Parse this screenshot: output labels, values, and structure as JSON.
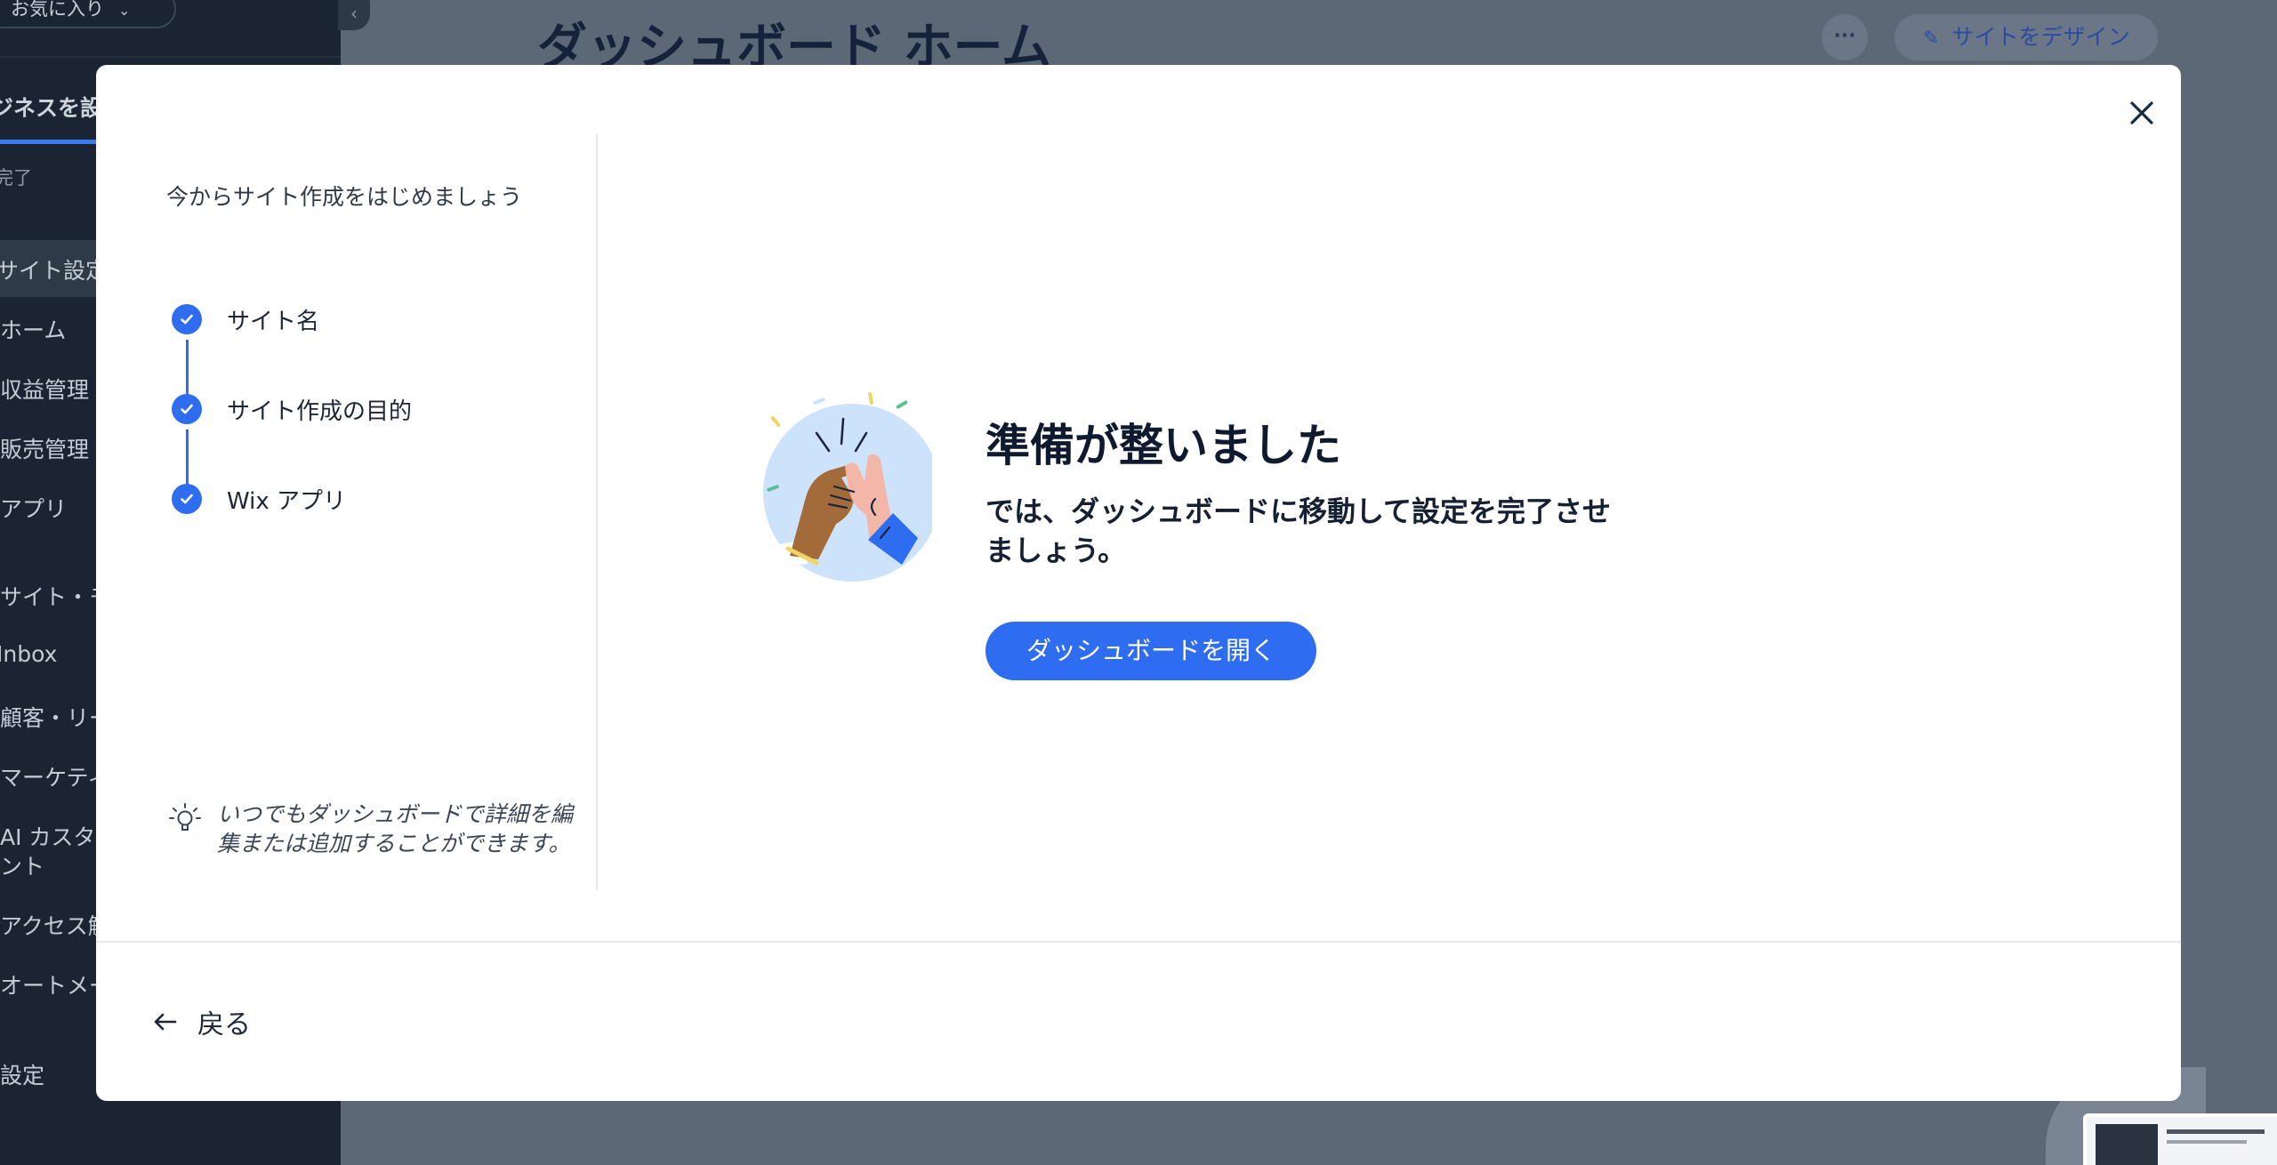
{
  "background": {
    "favorites_label": "お気に入り",
    "setup_title": "ジネスを設",
    "setup_done": "完了",
    "nav_items": [
      "サイト設定",
      "ホーム",
      "収益管理",
      "販売管理",
      "アプリ",
      "サイト・モ",
      "Inbox",
      "顧客・リー",
      "マーケティ",
      "AI カスタ",
      "ント",
      "アクセス解",
      "オートメー",
      "設定"
    ],
    "page_title": "ダッシュボード ホーム",
    "more_label": "···",
    "design_button": "サイトをデザイン"
  },
  "modal": {
    "steps_title": "今からサイト作成をはじめましょう",
    "steps": [
      {
        "label": "サイト名",
        "done": true
      },
      {
        "label": "サイト作成の目的",
        "done": true
      },
      {
        "label": "Wix アプリ",
        "done": true
      }
    ],
    "tip": "いつでもダッシュボードで詳細を編集または追加することができます。",
    "headline": "準備が整いました",
    "subtext": "では、ダッシュボードに移動して設定を完了させましょう。",
    "cta_label": "ダッシュボードを開く",
    "back_label": "戻る"
  },
  "colors": {
    "accent": "#2f6df0",
    "overlay": "#5d6877",
    "sidebar": "#1a2433"
  },
  "icons": {
    "close": "close-icon",
    "check": "check-icon",
    "tip": "lightbulb-icon",
    "back": "arrow-left-icon"
  }
}
